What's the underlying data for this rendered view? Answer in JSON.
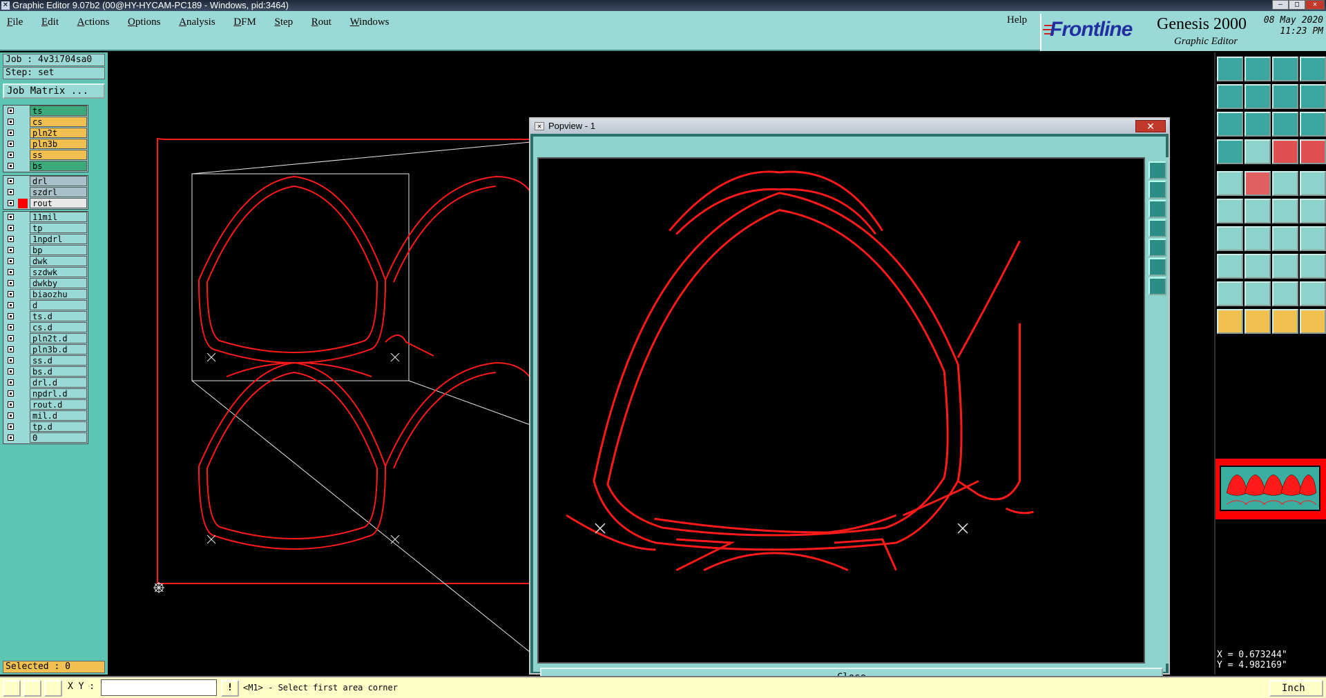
{
  "window": {
    "title": "Graphic Editor 9.07b2 (00@HY-HYCAM-PC189 - Windows, pid:3464)"
  },
  "menubar": {
    "items": [
      "File",
      "Edit",
      "Actions",
      "Options",
      "Analysis",
      "DFM",
      "Step",
      "Rout",
      "Windows"
    ],
    "help": "Help"
  },
  "brand": {
    "logo": "Frontline",
    "product": "Genesis 2000",
    "subtitle": "Graphic Editor",
    "date": "08 May 2020",
    "time": "11:23 PM"
  },
  "left_panel": {
    "job": "Job : 4v3i704sa0",
    "step": "Step: set",
    "job_matrix": "Job Matrix ...",
    "board_layers": [
      {
        "name": "ts",
        "color": "#3aaa78"
      },
      {
        "name": "cs",
        "color": "#f0c050"
      },
      {
        "name": "pln2t",
        "color": "#f0c050"
      },
      {
        "name": "pln3b",
        "color": "#f0c050"
      },
      {
        "name": "ss",
        "color": "#f0c050"
      },
      {
        "name": "bs",
        "color": "#3aaa78"
      }
    ],
    "drill_layers": [
      {
        "name": "drl",
        "color": "#a8c0c8",
        "active": false
      },
      {
        "name": "szdrl",
        "color": "#a8c0c8",
        "active": false
      },
      {
        "name": "rout",
        "color": "#e8e8e8",
        "active": true,
        "swatch": "#ff0000"
      }
    ],
    "misc_layers": [
      "11mil",
      "tp",
      "1npdrl",
      "bp",
      "dwk",
      "szdwk",
      "dwkby",
      "biaozhu",
      "d",
      "ts.d",
      "cs.d",
      "pln2t.d",
      "pln3b.d",
      "ss.d",
      "bs.d",
      "drl.d",
      "npdrl.d",
      "rout.d",
      "mil.d",
      "tp.d",
      "0"
    ],
    "selected": "Selected : 0"
  },
  "popview": {
    "title": "Popview - 1",
    "close_label": "Close",
    "close_x": "✕"
  },
  "coords": {
    "x": "X = 0.673244\"",
    "y": "Y = 4.982169\""
  },
  "statusbar": {
    "xy_label": "X Y :",
    "xy_value": "",
    "message": "<M1> - Select first area corner",
    "unit": "Inch"
  },
  "colors": {
    "teal": "#9ad9d6",
    "teal_dark": "#5ec4b4",
    "rout": "#ff0000",
    "status_bg": "#fffec8"
  }
}
